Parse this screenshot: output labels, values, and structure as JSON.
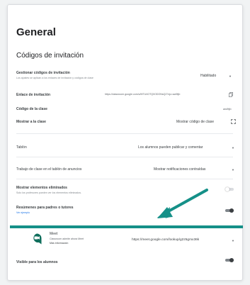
{
  "page_title": "General",
  "invite": {
    "section_title": "Códigos de invitación",
    "manage_label": "Gestionar códigos de invitación",
    "manage_desc": "Los ajustes se aplican a los enlaces de invitación y códigos de clase",
    "manage_value": "Habilitado",
    "link_label": "Enlace de invitación",
    "link_value": "https://classroom.google.com/c/MTU4OTQ0ODONsQ2?cjc=aw9tjb",
    "code_label": "Código de la clase",
    "code_value": "aw9tjb",
    "show_label": "Mostrar a la clase",
    "show_value": "Mostrar código de clase"
  },
  "board": {
    "label": "Tablón",
    "value": "Los alumnos pueden publicar y comentar"
  },
  "classwork": {
    "label": "Trabajo de clase en el tablón de anuncios",
    "value": "Mostrar notificaciones contraídas"
  },
  "deleted": {
    "label": "Mostrar elementos eliminados",
    "desc": "Solo los profesores pueden ver los elementos eliminados."
  },
  "guardian": {
    "label": "Resúmenes para padres o tutores",
    "desc": "Ver ejemplo"
  },
  "meet": {
    "title": "Meet",
    "desc": "Classroom admite ahora Meet",
    "more": "Más información",
    "link": "https://meet.google.com/lookup/g2z5gmx36k",
    "visible_label": "Visible para los alumnos"
  },
  "colors": {
    "accent_teal": "#159088",
    "meet_green": "#0f6e5c"
  }
}
